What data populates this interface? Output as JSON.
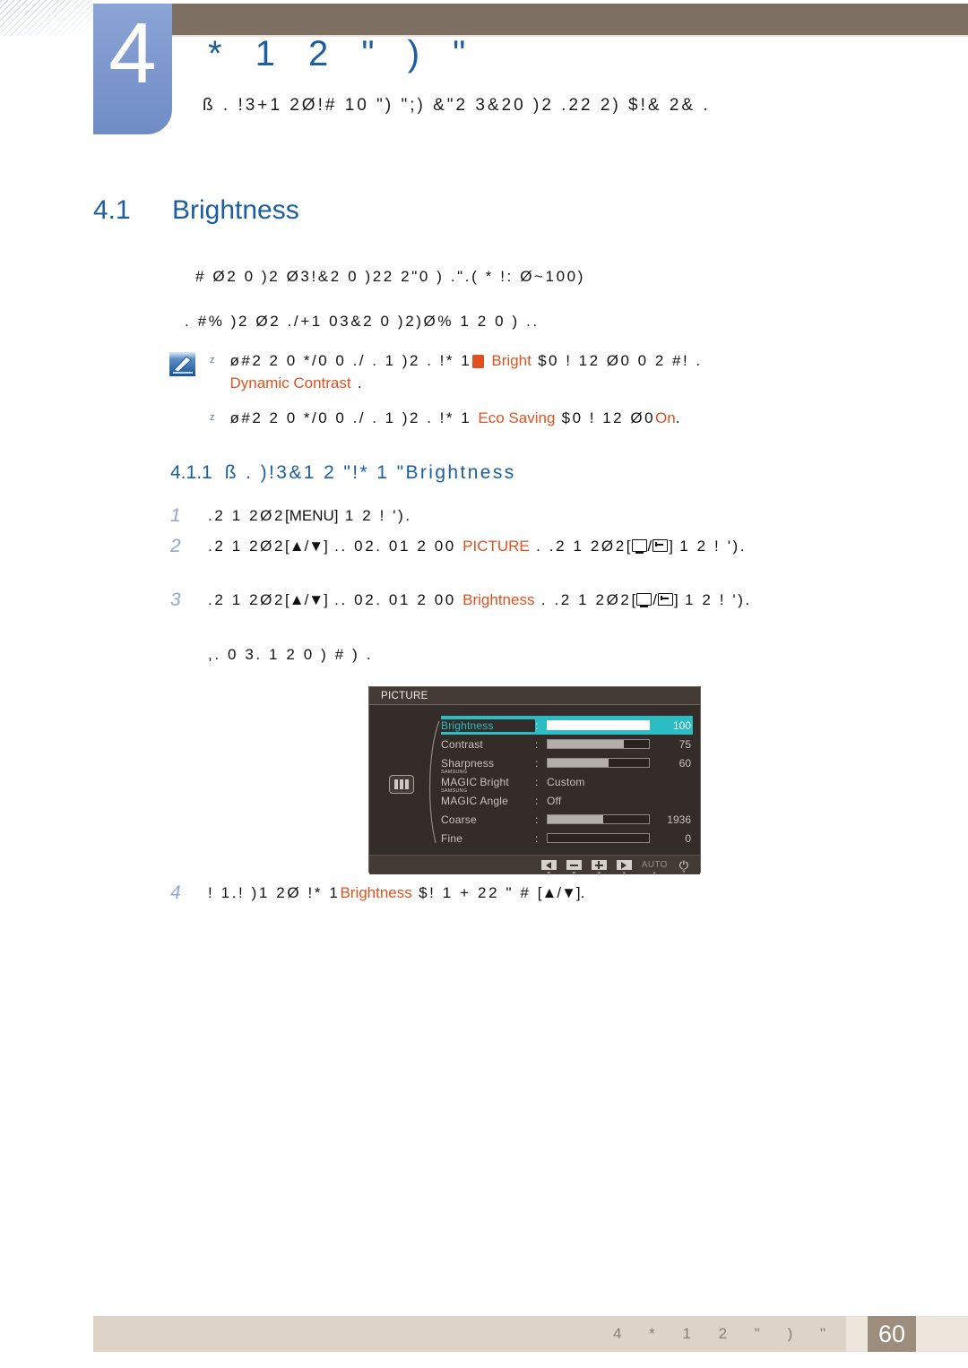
{
  "chapter": {
    "number": "4",
    "title": "*   1 2 \" )  \"",
    "subtitle": "ß .  !3+1 2Ø!#   10 \")  \";) &\"2 3&20  )2 .22  2)  $!&   2& ."
  },
  "section": {
    "number": "4.1",
    "name": "Brightness"
  },
  "intro": {
    "line1": "#     Ø2  0    )2 Ø3!&2 0   )22 2\"0   ) .\".( * !: Ø~100)",
    "line2": ". #%   )2 Ø2    ./+1 03&2 0   )2)Ø% 1 2  0   ) .."
  },
  "note": {
    "icon": "note-pencil-icon",
    "bullet": "z",
    "items": [
      {
        "pre": "ø#2 2  0   */0 0  ./ .  1  )2 .  !*    1",
        "badge_icon": "samsung-magic-icon",
        "term1": "Bright",
        "mid": "$0 ! 12 Ø0  0 2 #! .",
        "term2": "Dynamic Contrast",
        "post": "."
      },
      {
        "pre": "ø#2 2  0   */0 0  ./ .  1  )2 .  !*    1",
        "term1": "Eco Saving",
        "mid": "$0 ! 12 Ø0",
        "term2": "On",
        "post": "."
      }
    ]
  },
  "subsection": {
    "number": "4.1.1",
    "text": "ß .  )!3&1 2 \"!*    1  \"",
    "term": "Brightness"
  },
  "steps": [
    {
      "no": "1",
      "seg1": ".2 1 2Ø2",
      "key1": "[MENU]",
      "seg2": "1 2  ! ').",
      "term": "",
      "seg3": ""
    },
    {
      "no": "2",
      "seg1": ".2 1 2Ø2",
      "key1": "[▲/▼]",
      "seg2": " ..  02.      01 2 00",
      "term": "PICTURE",
      "seg3": ". .2 1 2Ø2",
      "key2": "[  /  ]",
      "seg4": "1 2   ! ')."
    },
    {
      "no": "3",
      "seg1": ".2 1 2Ø2",
      "key1": "[▲/▼]",
      "seg2": " ..  02.      01 2 00",
      "term": "Brightness",
      "seg3": ". .2 1 2Ø2",
      "key2": "[  /  ]",
      "seg4": "1 2   ! ').",
      "substep": ",. 0 3. 1 2 0 ) #    ) ."
    },
    {
      "no": "4",
      "seg1": "! 1.! )1 2Ø !*     1",
      "term": "Brightness",
      "seg3": "$! 1         + 22 \"  #",
      "key1": "[▲/▼]",
      "seg4": "."
    }
  ],
  "osd": {
    "title": "PICTURE",
    "category_icon": "picture-category-icon",
    "rows": [
      {
        "label": "Brightness",
        "type": "slider",
        "value": "100",
        "fill_pct": 100,
        "selected": true
      },
      {
        "label": "Contrast",
        "type": "slider",
        "value": "75",
        "fill_pct": 75,
        "selected": false
      },
      {
        "label": "Sharpness",
        "type": "slider",
        "value": "60",
        "fill_pct": 60,
        "selected": false
      },
      {
        "label": "Bright",
        "magic": true,
        "magic_sup": "SAMSUNG",
        "magic_main": "MAGIC",
        "type": "text",
        "value": "Custom",
        "selected": false
      },
      {
        "label": "Angle",
        "magic": true,
        "magic_sup": "SAMSUNG",
        "magic_main": "MAGIC",
        "type": "text",
        "value": "Off",
        "selected": false
      },
      {
        "label": "Coarse",
        "type": "slider",
        "value": "1936",
        "fill_pct": 55,
        "selected": false
      },
      {
        "label": "Fine",
        "type": "slider",
        "value": "0",
        "fill_pct": 0,
        "selected": false
      }
    ],
    "footer_buttons": [
      {
        "icon": "arrow-left-icon",
        "caption": "▼"
      },
      {
        "icon": "minus-icon",
        "caption": "▼"
      },
      {
        "icon": "plus-icon",
        "caption": "▼"
      },
      {
        "icon": "arrow-right-icon",
        "caption": "▾"
      },
      {
        "icon": "auto-label",
        "label": "AUTO",
        "caption": "▾"
      },
      {
        "icon": "power-icon",
        "label": "⏻",
        "caption": "▾"
      }
    ]
  },
  "footer": {
    "text": "4  *   1 2 \"  )   \"",
    "page": "60"
  },
  "colors": {
    "header_brown": "#7d7062",
    "tab_blue": "#7f99cf",
    "heading_blue": "#1c5ea0",
    "accent_orange": "#e0511f",
    "osd_highlight": "#2bbcc4",
    "footer_band": "#ddd3c6",
    "page_box": "#9d8d7d"
  }
}
